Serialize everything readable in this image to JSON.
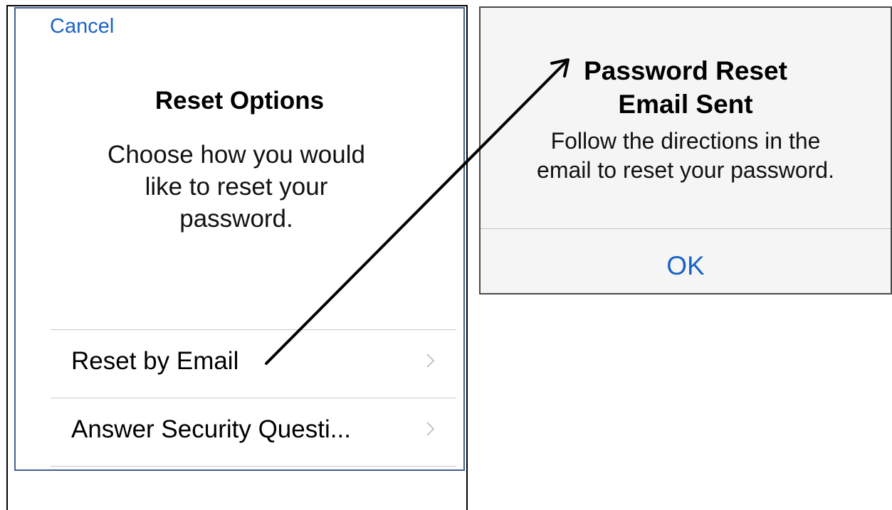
{
  "reset_options": {
    "cancel_label": "Cancel",
    "title": "Reset Options",
    "description_lines": [
      "Choose how you would",
      "like to reset your",
      "password."
    ],
    "options": [
      {
        "label": "Reset by Email",
        "chevron": "chevron-right-icon"
      },
      {
        "label": "Answer Security Questi...",
        "chevron": "chevron-right-icon"
      }
    ]
  },
  "alert": {
    "title_lines": [
      "Password Reset",
      "Email Sent"
    ],
    "message_lines": [
      "Follow the directions in the",
      "email to reset your password."
    ],
    "ok_label": "OK"
  },
  "colors": {
    "link_blue": "#1a63c6",
    "separator": "#c9c9c9",
    "alert_background": "#f5f5f5"
  }
}
